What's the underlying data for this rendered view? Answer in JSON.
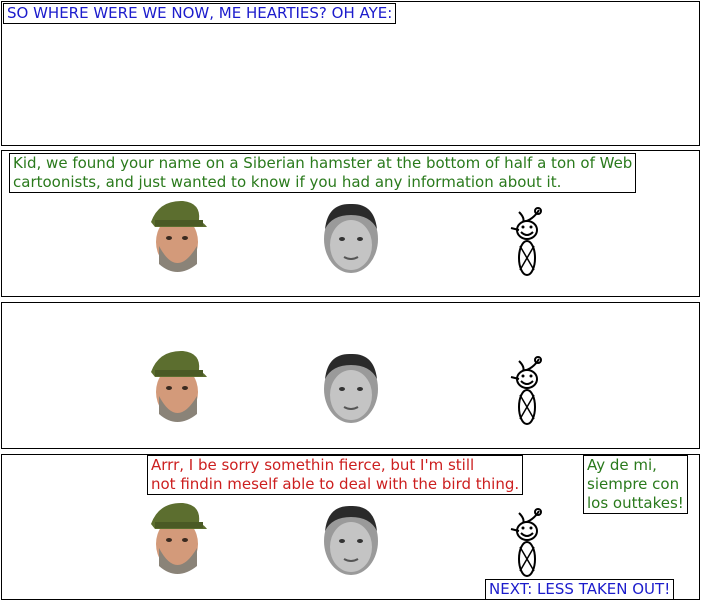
{
  "colors": {
    "blue_text": "#1c1ccc",
    "green_text": "#2a7a1c",
    "red_text": "#cc1f1f",
    "border": "#000000"
  },
  "panel1": {
    "caption": "SO WHERE WERE WE NOW, ME HEARTIES?  OH AYE:"
  },
  "panel2": {
    "caption": "Kid, we found your name on a Siberian hamster at the bottom of half a ton of Web\ncartoonists, and just wanted to know if you had any information about it."
  },
  "panel4": {
    "caption_left": "Arrr, I be sorry somethin fierce, but I'm still\nnot findin meself able to deal with the bird thing.",
    "caption_right": "Ay de mi,\nsiempre con\nlos outtakes!",
    "next_link": "NEXT: LESS TAKEN OUT!"
  },
  "icons": {
    "cap_man": "cap-man-icon",
    "bald_man": "bald-man-icon",
    "bird": "bird-icon"
  }
}
